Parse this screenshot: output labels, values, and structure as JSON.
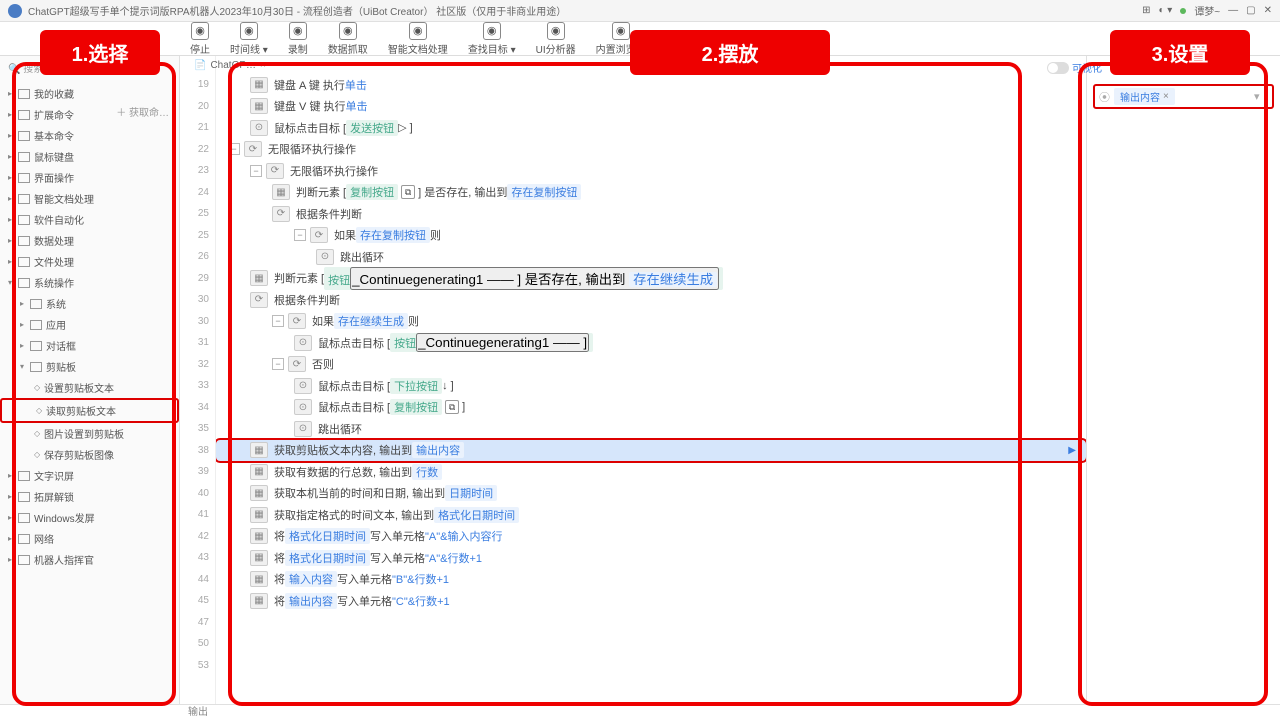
{
  "window": {
    "title": "ChatGPT超级写手单个提示词版RPA机器人2023年10月30日 - 流程创造者（UiBot Creator） 社区版（仅用于非商业用途）",
    "user": "谭梦~"
  },
  "toolbar": [
    {
      "label": "停止"
    },
    {
      "label": "时间线 ▾"
    },
    {
      "label": "录制"
    },
    {
      "label": "数据抓取"
    },
    {
      "label": "智能文档处理"
    },
    {
      "label": "查找目标 ▾"
    },
    {
      "label": "UI分析器"
    },
    {
      "label": "内置浏览器"
    }
  ],
  "search_placeholder": "搜索命令",
  "getlink": "＋ 获取命…",
  "tree": [
    {
      "t": "我的收藏",
      "l": 0
    },
    {
      "t": "扩展命令",
      "l": 0,
      "extra": true
    },
    {
      "t": "基本命令",
      "l": 0
    },
    {
      "t": "鼠标键盘",
      "l": 0
    },
    {
      "t": "界面操作",
      "l": 0
    },
    {
      "t": "智能文档处理",
      "l": 0
    },
    {
      "t": "软件自动化",
      "l": 0
    },
    {
      "t": "数据处理",
      "l": 0
    },
    {
      "t": "文件处理",
      "l": 0
    },
    {
      "t": "系统操作",
      "l": 0,
      "open": true
    },
    {
      "t": "系统",
      "l": 1
    },
    {
      "t": "应用",
      "l": 1
    },
    {
      "t": "对话框",
      "l": 1
    },
    {
      "t": "剪贴板",
      "l": 1,
      "open": true
    },
    {
      "t": "设置剪贴板文本",
      "l": 2,
      "leaf": true
    },
    {
      "t": "读取剪贴板文本",
      "l": 2,
      "leaf": true,
      "hl": true
    },
    {
      "t": "图片设置到剪贴板",
      "l": 2,
      "leaf": true
    },
    {
      "t": "保存剪贴板图像",
      "l": 2,
      "leaf": true
    },
    {
      "t": "文字识屏",
      "l": 0
    },
    {
      "t": "拓屏解锁",
      "l": 0
    },
    {
      "t": "Windows发屏",
      "l": 0
    },
    {
      "t": "网络",
      "l": 0
    },
    {
      "t": "机器人指挥官",
      "l": 0
    }
  ],
  "tab": "ChatGP…",
  "lines": [
    "19",
    "20",
    "21",
    "22",
    "23",
    "24",
    "25",
    "25",
    "26",
    "29",
    "30",
    "30",
    "31",
    "32",
    "33",
    "34",
    "35",
    "38",
    "39",
    "40",
    "41",
    "42",
    "43",
    "44",
    "45",
    "47",
    "50",
    "53"
  ],
  "rows": [
    {
      "i": 1,
      "parts": [
        {
          "b": 1
        },
        {
          "t": "键盘 A 键 执行 "
        },
        {
          "lk": "单击"
        }
      ]
    },
    {
      "i": 1,
      "parts": [
        {
          "b": 1
        },
        {
          "t": "键盘 V 键 执行 "
        },
        {
          "lk": "单击"
        }
      ]
    },
    {
      "i": 1,
      "parts": [
        {
          "b": 2
        },
        {
          "t": "鼠标点击目标 [ "
        },
        {
          "gr": "发送按钮"
        },
        {
          "t": "  ▷  ]"
        }
      ]
    },
    {
      "i": 0,
      "tog": 1,
      "parts": [
        {
          "b": 3
        },
        {
          "t": "无限循环执行操作"
        }
      ]
    },
    {
      "i": 1,
      "tog": 1,
      "parts": [
        {
          "b": 3
        },
        {
          "t": "无限循环执行操作"
        }
      ]
    },
    {
      "i": 2,
      "parts": [
        {
          "b": 1
        },
        {
          "t": "判断元素 [ "
        },
        {
          "gr": "复制按钮"
        },
        {
          "box": "⧉"
        },
        {
          "t": " ] 是否存在, 输出到 "
        },
        {
          "lb": "存在复制按钮"
        }
      ]
    },
    {
      "i": 2,
      "parts": [
        {
          "b": 3
        },
        {
          "t": "根据条件判断"
        }
      ]
    },
    {
      "i": 3,
      "tog": 1,
      "parts": [
        {
          "b": 3
        },
        {
          "t": "如果 "
        },
        {
          "lb": "存在复制按钮"
        },
        {
          "t": " 则"
        }
      ]
    },
    {
      "i": 4,
      "parts": [
        {
          "b": 2
        },
        {
          "t": "跳出循环"
        }
      ]
    },
    {
      "i": 1,
      "parts": [
        {
          "b": 1
        },
        {
          "t": "判断元素 [ "
        },
        {
          "gr": "按钮<button>_Continuegenerating1"
        },
        {
          "t": " —— ] 是否存在, 输出到 "
        },
        {
          "lb": "存在继续生成"
        }
      ]
    },
    {
      "i": 1,
      "parts": [
        {
          "b": 3
        },
        {
          "t": "根据条件判断"
        }
      ]
    },
    {
      "i": 2,
      "tog": 1,
      "parts": [
        {
          "b": 3
        },
        {
          "t": "如果 "
        },
        {
          "lb": "存在继续生成"
        },
        {
          "t": " 则"
        }
      ]
    },
    {
      "i": 3,
      "parts": [
        {
          "b": 2
        },
        {
          "t": "鼠标点击目标 [ "
        },
        {
          "gr": "按钮<button>_Continuegenerating1"
        },
        {
          "t": " —— ]"
        }
      ]
    },
    {
      "i": 2,
      "tog": 1,
      "parts": [
        {
          "b": 3
        },
        {
          "t": "否则"
        }
      ]
    },
    {
      "i": 3,
      "parts": [
        {
          "b": 2
        },
        {
          "t": "鼠标点击目标 [ "
        },
        {
          "gr": "下拉按钮"
        },
        {
          "t": "  ↓  ]"
        }
      ]
    },
    {
      "i": 3,
      "parts": [
        {
          "b": 2
        },
        {
          "t": "鼠标点击目标 [ "
        },
        {
          "gr": "复制按钮"
        },
        {
          "box": "⧉"
        },
        {
          "t": " ]"
        }
      ]
    },
    {
      "i": 3,
      "parts": [
        {
          "b": 2
        },
        {
          "t": "跳出循环"
        }
      ]
    },
    {
      "i": 1,
      "sel": true,
      "hl": true,
      "parts": [
        {
          "b": 1
        },
        {
          "t": "获取剪贴板文本内容, 输出到 "
        },
        {
          "lb": "输出内容"
        }
      ]
    },
    {
      "i": 1,
      "parts": [
        {
          "b": 1
        },
        {
          "t": "获取有数据的行总数, 输出到 "
        },
        {
          "lb": "行数"
        }
      ]
    },
    {
      "i": 1,
      "parts": [
        {
          "b": 1
        },
        {
          "t": "获取本机当前的时间和日期, 输出到 "
        },
        {
          "lb": "日期时间"
        }
      ]
    },
    {
      "i": 1,
      "parts": [
        {
          "b": 1
        },
        {
          "t": "获取指定格式的时间文本, 输出到 "
        },
        {
          "lb": "格式化日期时间"
        }
      ]
    },
    {
      "i": 1,
      "parts": [
        {
          "b": 1
        },
        {
          "t": "将 "
        },
        {
          "lb": "格式化日期时间"
        },
        {
          "t": " 写入单元格 "
        },
        {
          "lk": "\"A\"&输入内容行"
        }
      ]
    },
    {
      "i": 1,
      "parts": [
        {
          "b": 1
        },
        {
          "t": "将 "
        },
        {
          "lb": "格式化日期时间"
        },
        {
          "t": " 写入单元格 "
        },
        {
          "lk": "\"A\"&行数+1"
        }
      ]
    },
    {
      "i": 1,
      "parts": [
        {
          "b": 1
        },
        {
          "t": "将 "
        },
        {
          "lb": "输入内容"
        },
        {
          "t": " 写入单元格 "
        },
        {
          "lk": "\"B\"&行数+1"
        }
      ]
    },
    {
      "i": 1,
      "parts": [
        {
          "b": 1
        },
        {
          "t": "将 "
        },
        {
          "lb": "输出内容"
        },
        {
          "t": " 写入单元格 "
        },
        {
          "lk": "\"C\"&行数+1"
        }
      ]
    },
    {
      "i": 0,
      "parts": []
    },
    {
      "i": 0,
      "parts": []
    },
    {
      "i": 0,
      "parts": []
    }
  ],
  "right": {
    "vis": "可视化",
    "chip": "输出内容"
  },
  "footer": "输出",
  "badges": {
    "b1": "1.选择",
    "b2": "2.摆放",
    "b3": "3.设置"
  }
}
